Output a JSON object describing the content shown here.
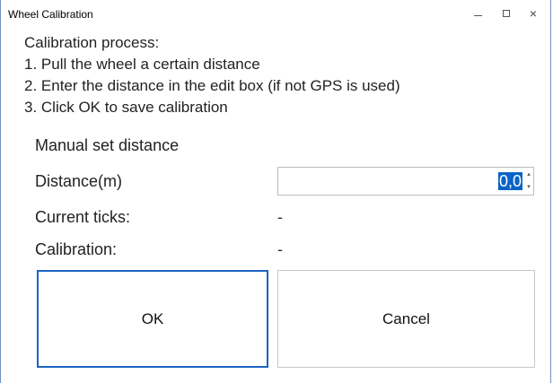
{
  "window": {
    "title": "Wheel Calibration",
    "controls": {
      "minimize": "–",
      "maximize": "□",
      "close": "×"
    }
  },
  "instructions": [
    "Calibration process:",
    "1. Pull the wheel a certain distance",
    "2. Enter the distance in the edit box (if not GPS is used)",
    "3. Click OK to save calibration"
  ],
  "manual": {
    "section_label": "Manual set distance",
    "distance_label": "Distance(m)",
    "distance_value": "0,0"
  },
  "status": {
    "ticks_label": "Current ticks:",
    "ticks_value": "-",
    "calibration_label": "Calibration:",
    "calibration_value": "-"
  },
  "buttons": {
    "ok": "OK",
    "cancel": "Cancel"
  },
  "colors": {
    "accent": "#1a64c2",
    "selection": "#0a63c8",
    "window_border": "#6f8fc7"
  }
}
